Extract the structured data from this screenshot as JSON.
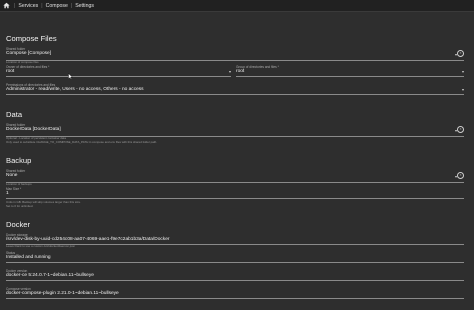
{
  "breadcrumb": {
    "items": [
      "Services",
      "Compose",
      "Settings"
    ]
  },
  "compose_files": {
    "title": "Compose Files",
    "shared_folder": {
      "label": "Shared folder",
      "value": "Compose [Compose]"
    },
    "location_hint": "Location of compose files",
    "owner": {
      "label": "Owner of directories and files *",
      "value": "root"
    },
    "group": {
      "label": "Group of directories and files *",
      "value": "root"
    },
    "permissions": {
      "label": "Permissions of directories and files",
      "value": "Administrator - read/write, Users - no access, Others - no access"
    }
  },
  "data": {
    "title": "Data",
    "shared_folder": {
      "label": "Shared folder",
      "value": "DockerData [DockerData]"
    },
    "hint1": "Optional - Location of persistent container data",
    "hint2": "Only used to substitute CHANGE_TO_COMPOSE_DATA_PATH in compose and env files with this shared folder path."
  },
  "backup": {
    "title": "Backup",
    "shared_folder": {
      "label": "Shared folder",
      "value": "None"
    },
    "location_hint": "Location of backups",
    "max_size": {
      "label": "Max Size *",
      "value": "1"
    },
    "hint1": "Units in GB. Backup will skip volumes larger than this size.",
    "hint2": "Set to 0 for unlimited."
  },
  "docker": {
    "title": "Docker",
    "storage": {
      "label": "Docker storage",
      "value": "/srv/dev-disk-by-uuid-cd254c08-aa07-4069-aae1-f9e7c2ab1b3a/Data/Docker",
      "hint": "Leave blank to use a custom /etc/docker/daemon.json"
    },
    "status": {
      "label": "Status",
      "value": "Installed and running"
    },
    "version": {
      "label": "Docker version",
      "value": "docker-ce 5:24.0.7-1~debian.11~bullseye"
    },
    "compose_version": {
      "label": "Compose version",
      "value": "docker-compose-plugin 2.21.0-1~debian.11~bullseye"
    }
  },
  "icons": {
    "home": "home-icon",
    "dropdown": "chevron-down-icon",
    "clear": "clear-icon"
  }
}
